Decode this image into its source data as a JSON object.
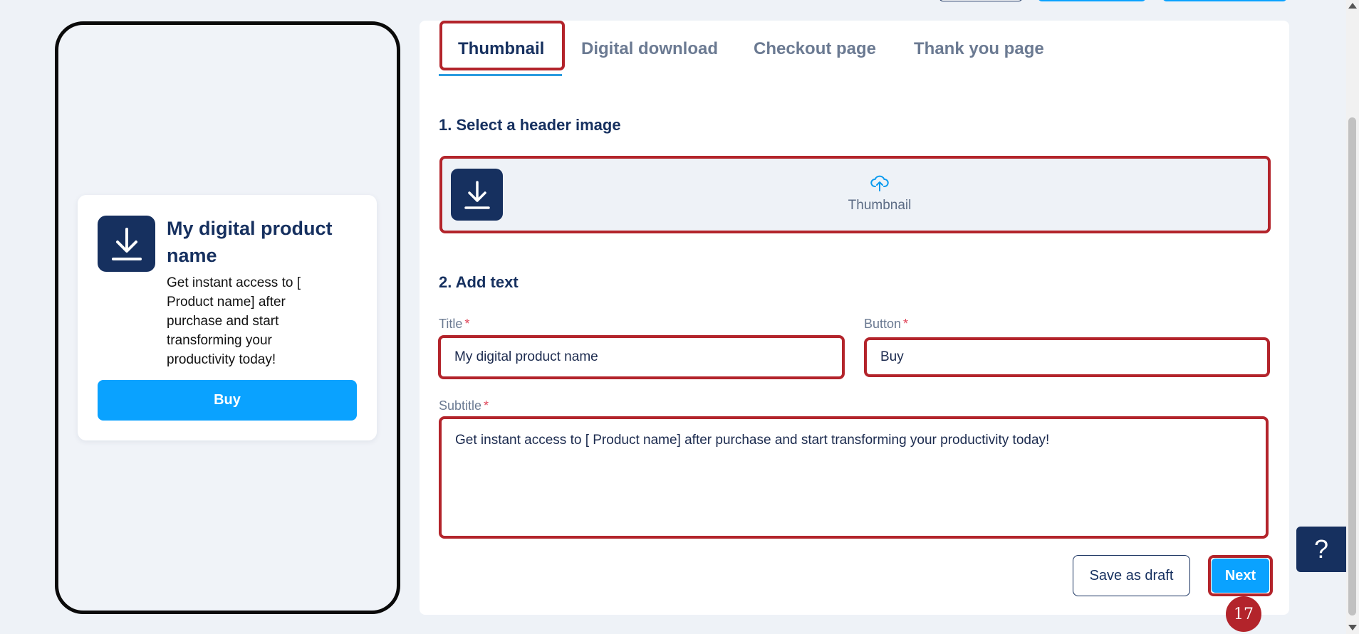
{
  "preview": {
    "title": "My digital product name",
    "subtitle": "Get instant access to [ Product name] after purchase and start transforming your productivity today!",
    "button": "Buy",
    "icon": "download-icon"
  },
  "tabs": [
    {
      "label": "Thumbnail",
      "active": true
    },
    {
      "label": "Digital download",
      "active": false
    },
    {
      "label": "Checkout page",
      "active": false
    },
    {
      "label": "Thank you page",
      "active": false
    }
  ],
  "sections": {
    "header_image": "1. Select a header image",
    "add_text": "2. Add text"
  },
  "upload": {
    "label": "Thumbnail",
    "icon": "cloud-upload-icon"
  },
  "form": {
    "title_label": "Title",
    "title_value": "My digital product name",
    "button_label": "Button",
    "button_value": "Buy",
    "subtitle_label": "Subtitle",
    "subtitle_value": "Get instant access to [ Product name] after purchase and start transforming your productivity today!",
    "required_mark": "*"
  },
  "actions": {
    "save_draft": "Save as draft",
    "next": "Next"
  },
  "step_badge": "17",
  "help": "?",
  "colors": {
    "navy": "#16305f",
    "accent_blue": "#0aa2ff",
    "highlight_red": "#b3242b",
    "background": "#eef2f7"
  }
}
